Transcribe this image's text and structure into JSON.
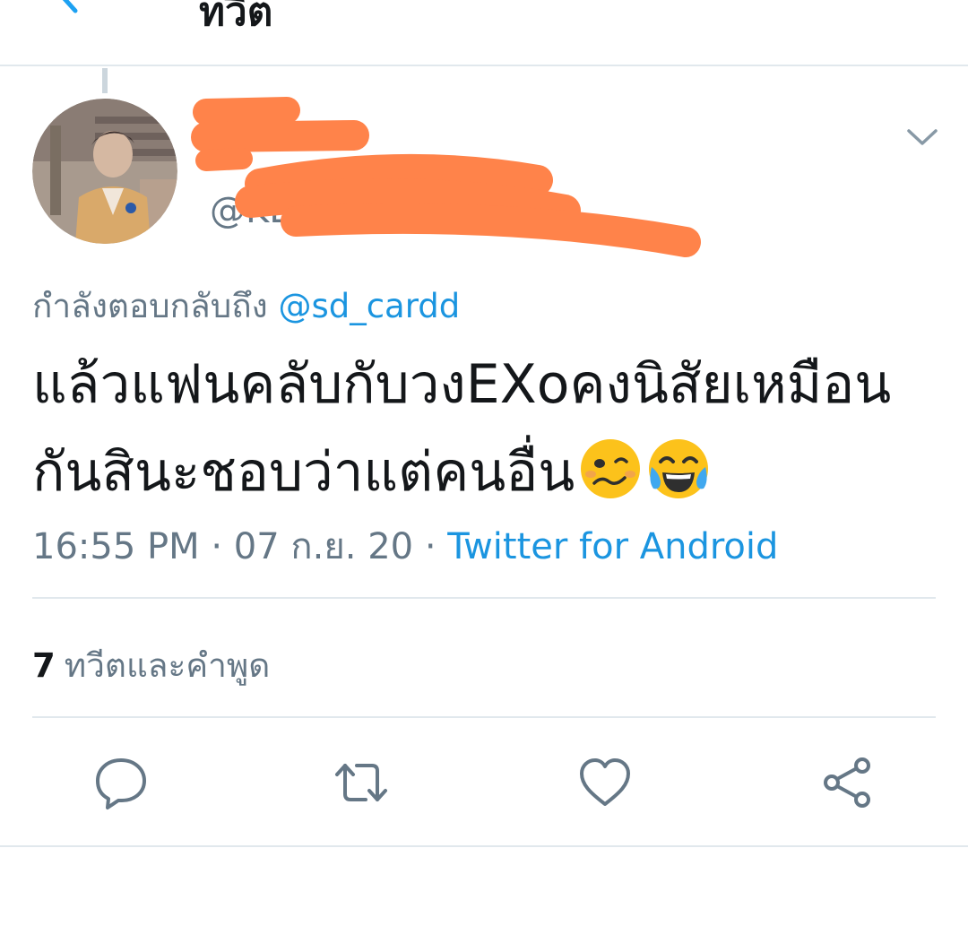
{
  "header": {
    "title": "ทวีต",
    "back_icon": "back-arrow-icon"
  },
  "tweet": {
    "display_name": "",
    "username": "@KL       08 78",
    "reply_prefix": "กำลังตอบกลับถึง",
    "reply_mention": "@sd_cardd",
    "text": "แล้วแฟนคลับกับวงEXoคงนิสัยเหมือนกันสินะชอบว่าแต่คนอื่น",
    "emojis": [
      "woozy-face",
      "face-with-tears-of-joy"
    ],
    "time": "16:55 PM",
    "separator": "·",
    "date": "07 ก.ย. 20",
    "source": "Twitter for Android"
  },
  "stats": {
    "count": "7",
    "label": "ทวีตและคำพูด"
  },
  "actions": {
    "reply": "reply-icon",
    "retweet": "retweet-icon",
    "like": "heart-icon",
    "share": "share-icon"
  },
  "colors": {
    "link": "#1b95e0",
    "secondary_text": "#657786",
    "primary_text": "#14171a",
    "divider": "#e1e8ed",
    "redaction": "#ff834a"
  }
}
